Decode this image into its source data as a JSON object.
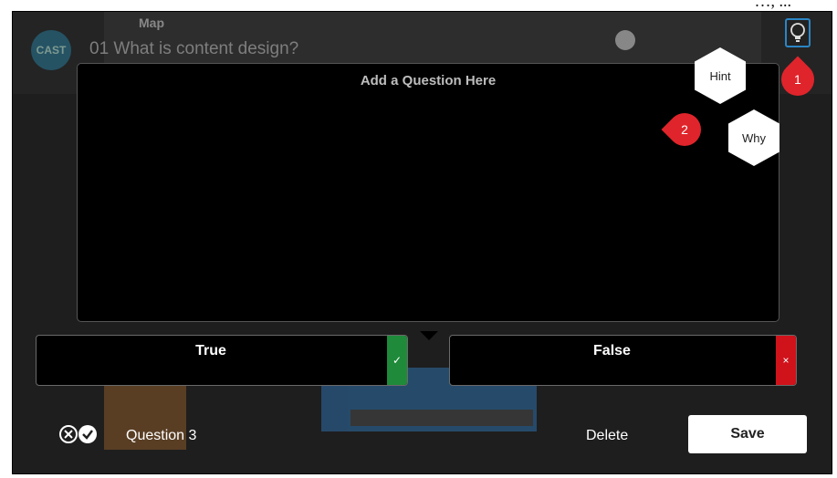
{
  "background": {
    "logo_text": "CAST",
    "nav_label": "Map",
    "lesson_title": "01 What is content design?"
  },
  "question": {
    "placeholder": "Add a Question Here"
  },
  "hex_buttons": {
    "hint_label": "Hint",
    "why_label": "Why"
  },
  "markers": {
    "marker_1": "1",
    "marker_2": "2"
  },
  "answers": [
    {
      "label": "True",
      "status": "correct",
      "status_symbol": "✓",
      "status_color": "#1e8a3a"
    },
    {
      "label": "False",
      "status": "incorrect",
      "status_symbol": "×",
      "status_color": "#d0121b"
    }
  ],
  "footer": {
    "question_type_icon": "true-false-icon",
    "question_label": "Question 3",
    "delete_label": "Delete",
    "save_label": "Save"
  },
  "colors": {
    "accent_blue": "#2b86c5",
    "marker_red": "#e0242b"
  },
  "icons": {
    "hint_toggle": "lightbulb-icon"
  }
}
